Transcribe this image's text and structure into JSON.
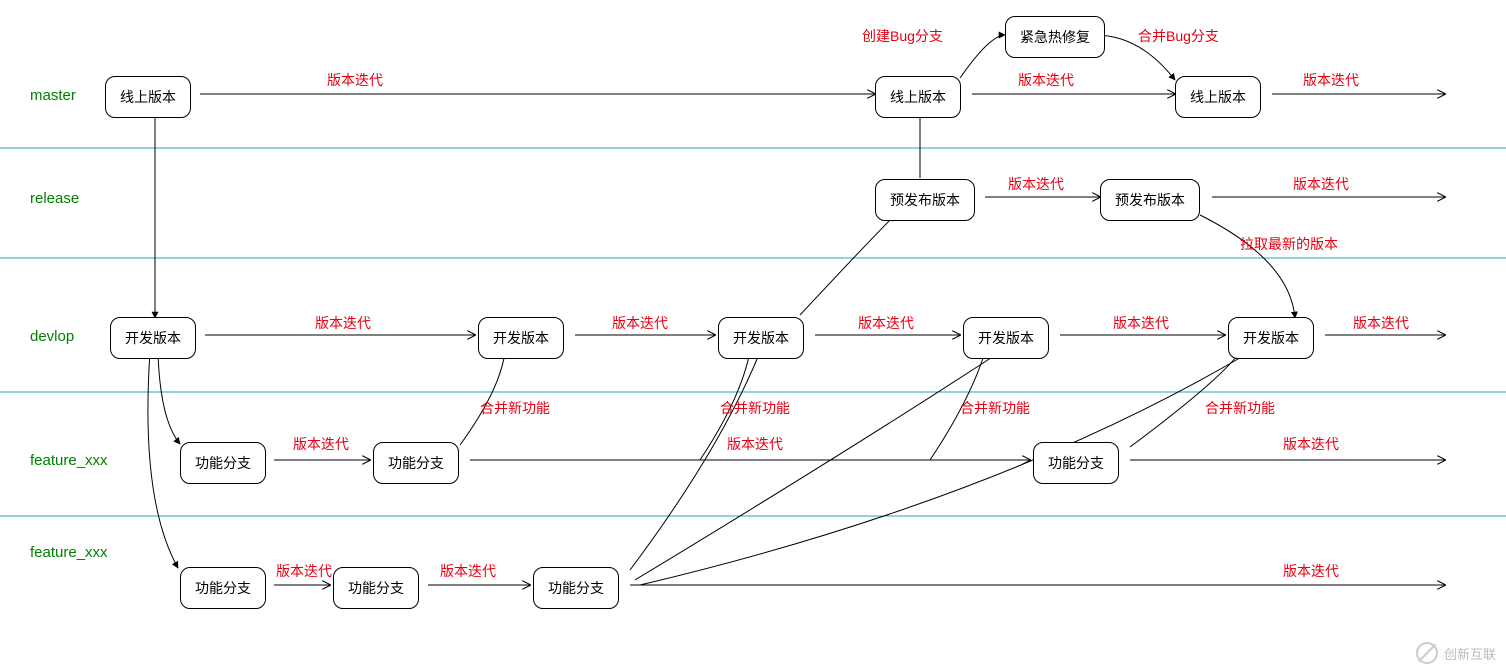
{
  "lanes": {
    "master": "master",
    "release": "release",
    "devlop": "devlop",
    "feature1": "feature_xxx",
    "feature2": "feature_xxx"
  },
  "nodes": {
    "m1": "线上版本",
    "m2": "线上版本",
    "m3": "线上版本",
    "hotfix": "紧急热修复",
    "r1": "预发布版本",
    "r2": "预发布版本",
    "d1": "开发版本",
    "d2": "开发版本",
    "d3": "开发版本",
    "d4": "开发版本",
    "d5": "开发版本",
    "f1a": "功能分支",
    "f1b": "功能分支",
    "f1c": "功能分支",
    "f2a": "功能分支",
    "f2b": "功能分支",
    "f2c": "功能分支"
  },
  "labels": {
    "iter1": "版本迭代",
    "iter2": "版本迭代",
    "iter3": "版本迭代",
    "iter4": "版本迭代",
    "iter5": "版本迭代",
    "iter6": "版本迭代",
    "iter7": "版本迭代",
    "iter8": "版本迭代",
    "iter9": "版本迭代",
    "iter10": "版本迭代",
    "iter11": "版本迭代",
    "iter12": "版本迭代",
    "iter13": "版本迭代",
    "iter14": "版本迭代",
    "iter15": "版本迭代",
    "iter16": "版本迭代",
    "createBug": "创建Bug分支",
    "mergeBug": "合并Bug分支",
    "merge1": "合并新功能",
    "merge2": "合并新功能",
    "merge3": "合并新功能",
    "merge4": "合并新功能",
    "pullLatest": "拉取最新的版本"
  },
  "watermark": "创新互联"
}
